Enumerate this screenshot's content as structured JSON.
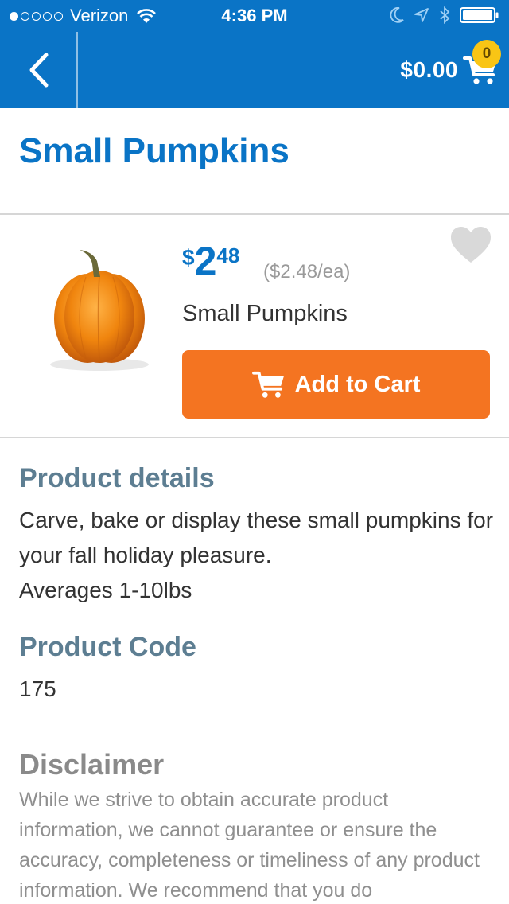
{
  "status_bar": {
    "carrier": "Verizon",
    "time": "4:36 PM",
    "signal_dots_filled": 1,
    "signal_dots_total": 5
  },
  "nav": {
    "back_icon": "chevron-left-icon",
    "cart_total": "$0.00",
    "cart_count": "0",
    "cart_icon": "shopping-cart-icon"
  },
  "page_title": "Small Pumpkins",
  "product": {
    "price_currency": "$",
    "price_dollars": "2",
    "price_cents": "48",
    "unit_price": "($2.48/ea)",
    "name": "Small Pumpkins",
    "add_to_cart_label": "Add to Cart",
    "favorite_icon": "heart-icon"
  },
  "details": {
    "heading": "Product details",
    "description": "Carve, bake or display these small pumpkins for your fall holiday pleasure.",
    "weight_note": "Averages 1-10lbs"
  },
  "product_code": {
    "heading": "Product Code",
    "value": "175"
  },
  "disclaimer": {
    "heading": "Disclaimer",
    "text": "While we strive to obtain accurate product information, we cannot guarantee or ensure the accuracy, completeness or timeliness of any product information. We recommend that you do"
  },
  "colors": {
    "brand_blue": "#0a74c6",
    "cta_orange": "#f47421",
    "badge_yellow": "#f9c515",
    "section_heading": "#5d7e92"
  }
}
